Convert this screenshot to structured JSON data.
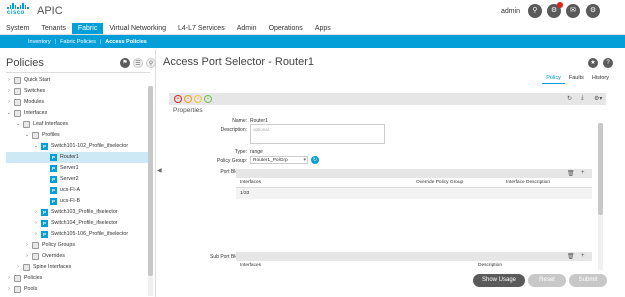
{
  "header": {
    "logo_text": "cisco",
    "app_name": "APIC",
    "user": "admin",
    "colors": {
      "brand": "#049fd9",
      "badge": "#e2231a"
    }
  },
  "nav": {
    "tabs": [
      {
        "label": "System"
      },
      {
        "label": "Tenants"
      },
      {
        "label": "Fabric",
        "active": true
      },
      {
        "label": "Virtual Networking"
      },
      {
        "label": "L4-L7 Services"
      },
      {
        "label": "Admin"
      },
      {
        "label": "Operations"
      },
      {
        "label": "Apps"
      }
    ]
  },
  "subnav": {
    "tabs": [
      {
        "label": "Inventory"
      },
      {
        "label": "Fabric Policies"
      },
      {
        "label": "Access Policies",
        "active": true
      }
    ]
  },
  "left": {
    "title": "Policies",
    "tree": [
      {
        "label": "Quick Start",
        "level": 0,
        "caret": "›",
        "icon": "folder"
      },
      {
        "label": "Switches",
        "level": 0,
        "caret": "›",
        "icon": "folder"
      },
      {
        "label": "Modules",
        "level": 0,
        "caret": "›",
        "icon": "folder"
      },
      {
        "label": "Interfaces",
        "level": 0,
        "caret": "⌄",
        "icon": "folder"
      },
      {
        "label": "Leaf Interfaces",
        "level": 1,
        "caret": "⌄",
        "icon": "folder"
      },
      {
        "label": "Profiles",
        "level": 2,
        "caret": "⌄",
        "icon": "folder"
      },
      {
        "label": "Switch101-102_Profile_ifselector",
        "level": 3,
        "caret": "⌄",
        "icon": "profile"
      },
      {
        "label": "Router1",
        "level": 4,
        "caret": "",
        "icon": "profile",
        "selected": true
      },
      {
        "label": "Server1",
        "level": 4,
        "caret": "",
        "icon": "profile"
      },
      {
        "label": "Server2",
        "level": 4,
        "caret": "",
        "icon": "profile"
      },
      {
        "label": "ucs-FI-A",
        "level": 4,
        "caret": "",
        "icon": "profile"
      },
      {
        "label": "ucs-FI-B",
        "level": 4,
        "caret": "",
        "icon": "profile"
      },
      {
        "label": "Switch103_Profile_ifselector",
        "level": 3,
        "caret": "›",
        "icon": "profile"
      },
      {
        "label": "Switch104_Profile_ifselector",
        "level": 3,
        "caret": "›",
        "icon": "profile"
      },
      {
        "label": "Switch105-106_Profile_ifselector",
        "level": 3,
        "caret": "›",
        "icon": "profile"
      },
      {
        "label": "Policy Groups",
        "level": 2,
        "caret": "›",
        "icon": "folder"
      },
      {
        "label": "Overrides",
        "level": 2,
        "caret": "›",
        "icon": "folder"
      },
      {
        "label": "Spine Interfaces",
        "level": 1,
        "caret": "›",
        "icon": "folder"
      },
      {
        "label": "Policies",
        "level": 0,
        "caret": "›",
        "icon": "folder"
      },
      {
        "label": "Pools",
        "level": 0,
        "caret": "›",
        "icon": "folder"
      }
    ]
  },
  "main": {
    "title": "Access Port Selector - Router1",
    "tabs": [
      {
        "label": "Policy",
        "active": true
      },
      {
        "label": "Faults"
      },
      {
        "label": "History"
      }
    ],
    "section": "Properties",
    "form": {
      "name_label": "Name:",
      "name_value": "Router1",
      "description_label": "Description:",
      "description_placeholder": "optional",
      "type_label": "Type:",
      "type_value": "range",
      "policy_group_label": "Policy Group:",
      "policy_group_value": "Router1_PolGrp",
      "port_blocks_label": "Port Blocks:",
      "sub_port_blocks_label": "Sub Port Blocks:"
    },
    "port_blocks": {
      "columns": [
        "Interfaces",
        "Override Policy Group",
        "Interface Description"
      ],
      "rows": [
        [
          "1/33",
          "",
          ""
        ]
      ]
    },
    "sub_port_blocks": {
      "columns": [
        "Interfaces",
        "Description"
      ]
    },
    "buttons": {
      "show_usage": "Show Usage",
      "reset": "Reset",
      "submit": "Submit"
    }
  }
}
